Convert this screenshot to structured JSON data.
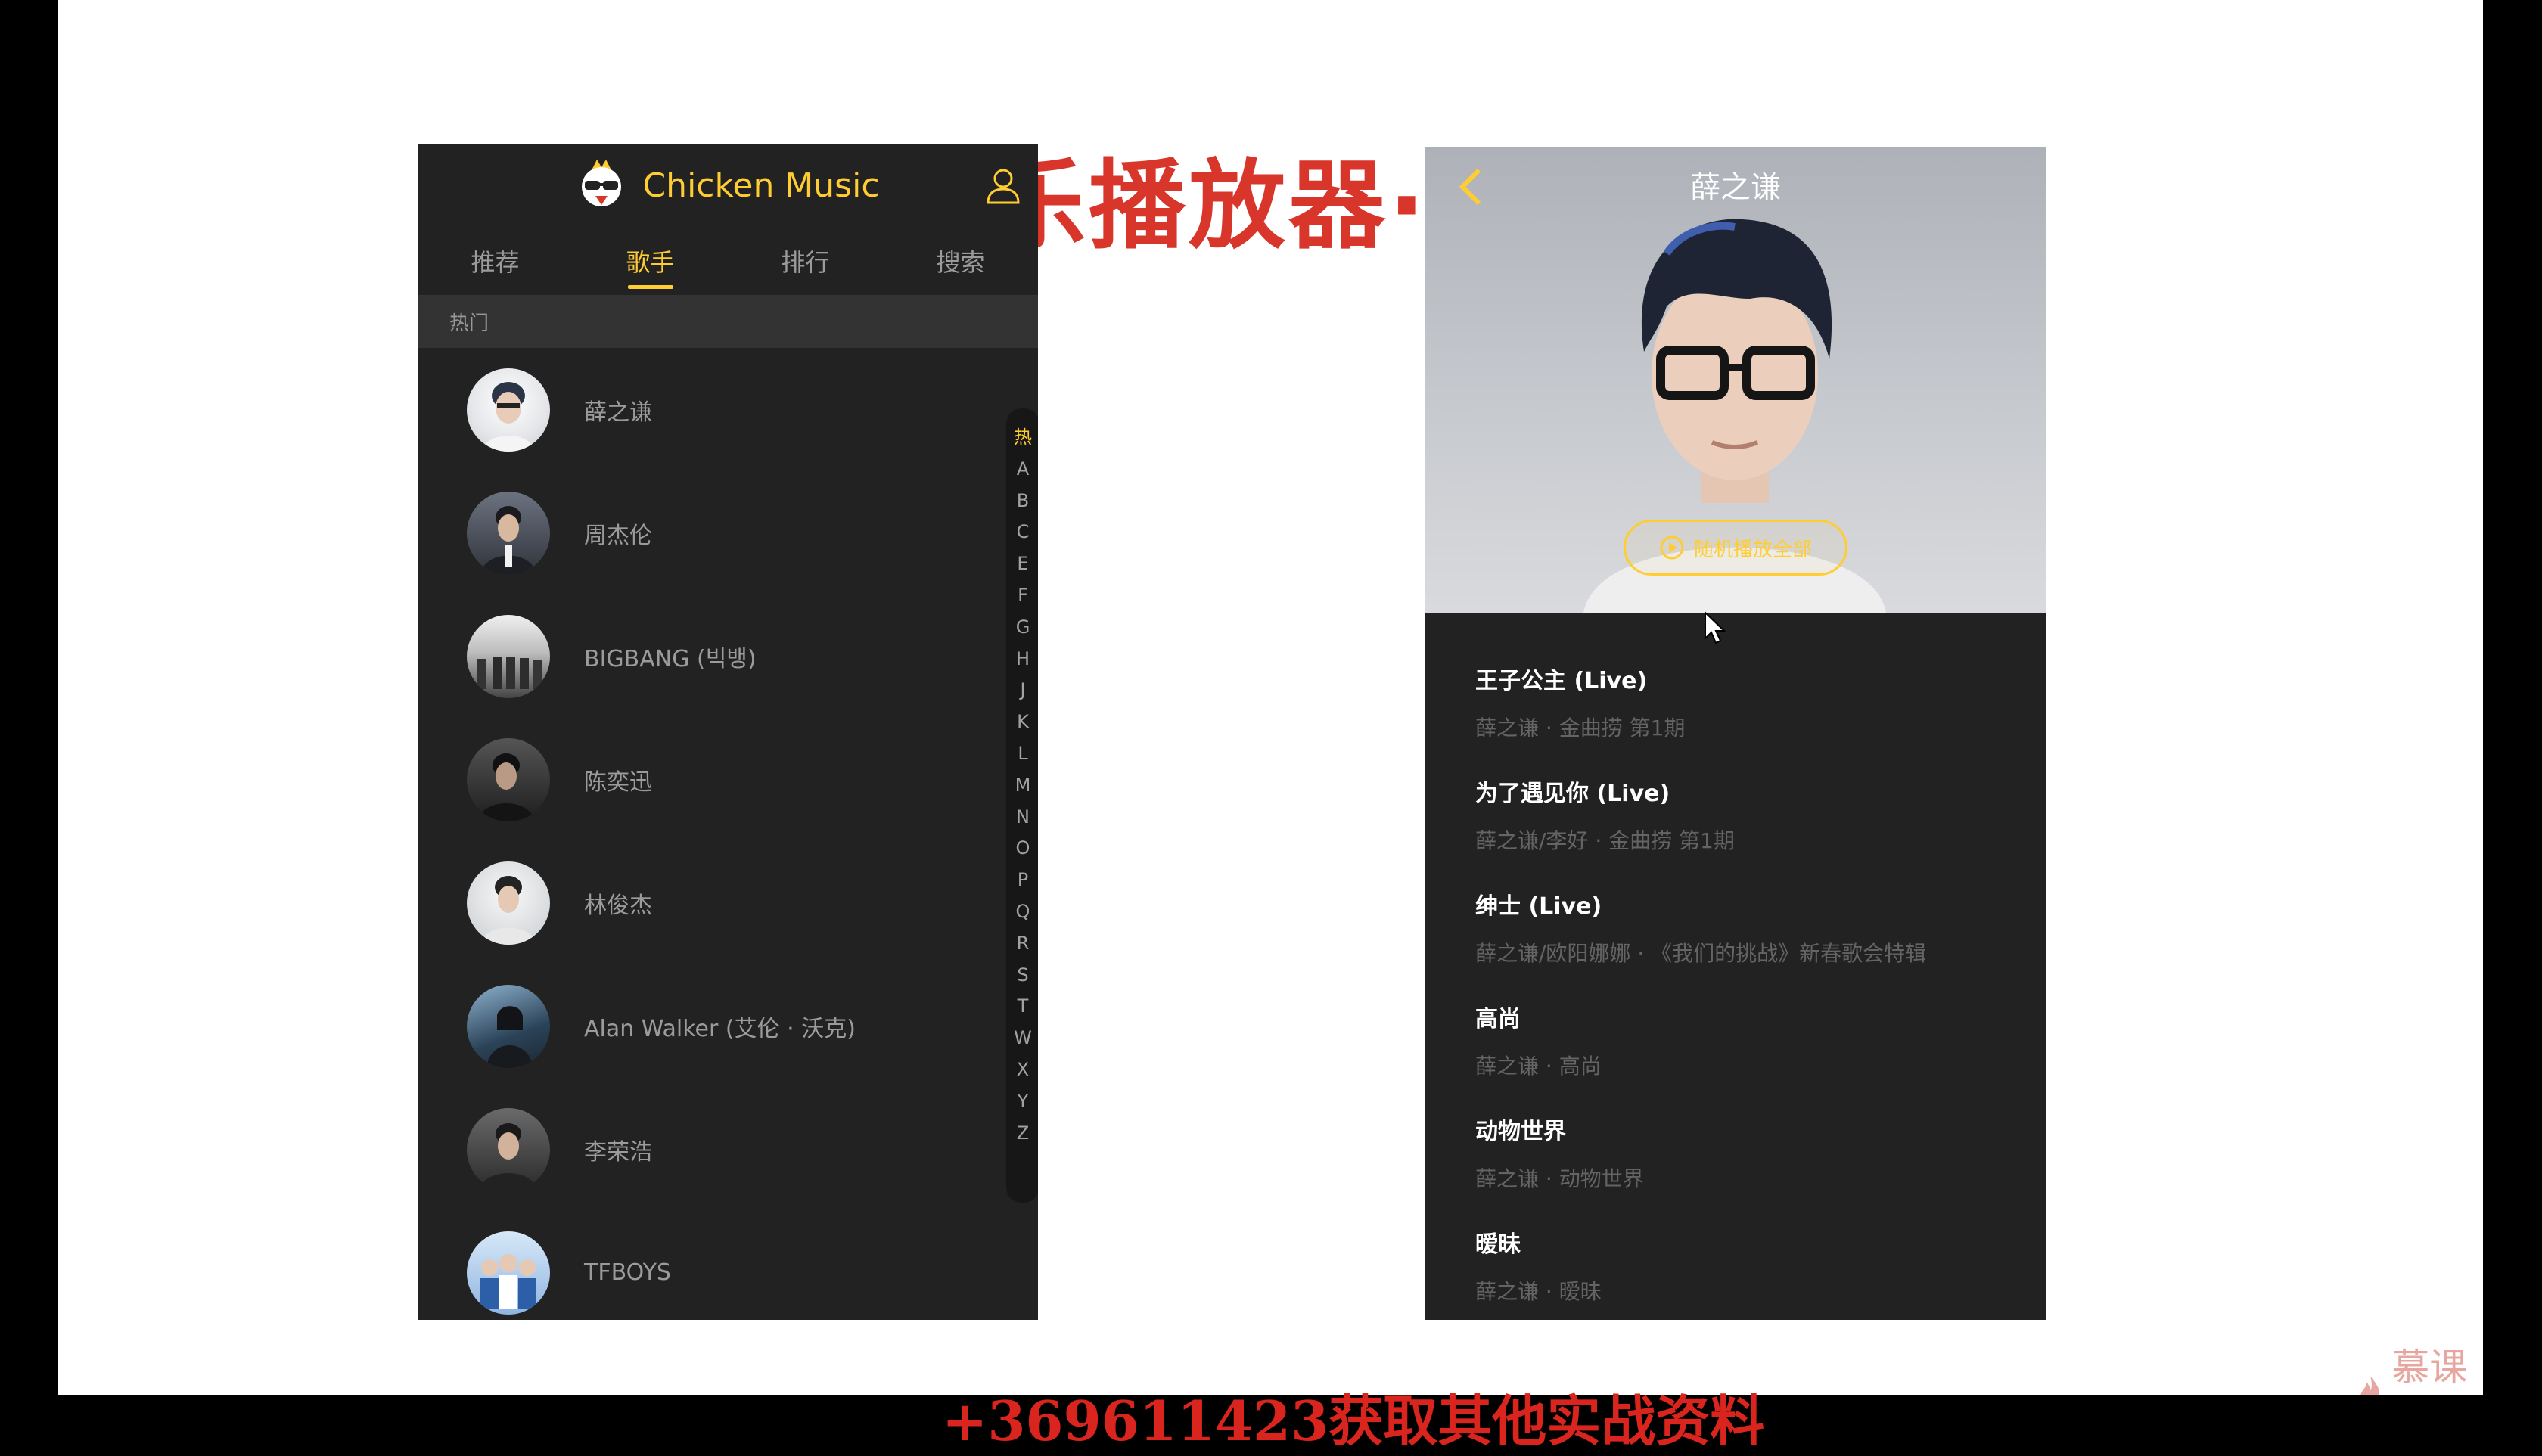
{
  "slide": {
    "title": "乐播放器·歌手",
    "caption": "+369611423获取其他实战资料",
    "watermark": "慕课网"
  },
  "app": {
    "title": "Chicken Music",
    "tabs": [
      {
        "label": "推荐"
      },
      {
        "label": "歌手"
      },
      {
        "label": "排行"
      },
      {
        "label": "搜索"
      }
    ],
    "group_title": "热门",
    "singers": [
      {
        "name": "薛之谦",
        "avatar_color": "#d9dce2"
      },
      {
        "name": "周杰伦",
        "avatar_color": "#4a4f5a"
      },
      {
        "name": "BIGBANG (빅뱅)",
        "avatar_color": "#9c9c9c"
      },
      {
        "name": "陈奕迅",
        "avatar_color": "#3a3a3a"
      },
      {
        "name": "林俊杰",
        "avatar_color": "#cfd2d6"
      },
      {
        "name": "Alan Walker (艾伦 · 沃克)",
        "avatar_color": "#33526b"
      },
      {
        "name": "李荣浩",
        "avatar_color": "#5a5a5a"
      },
      {
        "name": "TFBOYS",
        "avatar_color": "#5b8ecf"
      }
    ],
    "shortcut": [
      "热",
      "A",
      "B",
      "C",
      "E",
      "F",
      "G",
      "H",
      "J",
      "K",
      "L",
      "M",
      "N",
      "O",
      "P",
      "Q",
      "R",
      "S",
      "T",
      "W",
      "X",
      "Y",
      "Z"
    ]
  },
  "detail": {
    "singer_name": "薛之谦",
    "play_all_label": "随机播放全部",
    "songs": [
      {
        "name": "王子公主 (Live)",
        "desc": "薛之谦 · 金曲捞 第1期"
      },
      {
        "name": "为了遇见你 (Live)",
        "desc": "薛之谦/李好 · 金曲捞 第1期"
      },
      {
        "name": "绅士 (Live)",
        "desc": "薛之谦/欧阳娜娜 · 《我们的挑战》新春歌会特辑"
      },
      {
        "name": "高尚",
        "desc": "薛之谦 · 高尚"
      },
      {
        "name": "动物世界",
        "desc": "薛之谦 · 动物世界"
      },
      {
        "name": "暧昧",
        "desc": "薛之谦 · 暧昧"
      }
    ]
  },
  "colors": {
    "accent": "#ffcd32",
    "background": "#222222",
    "title_red": "#d9362b"
  }
}
